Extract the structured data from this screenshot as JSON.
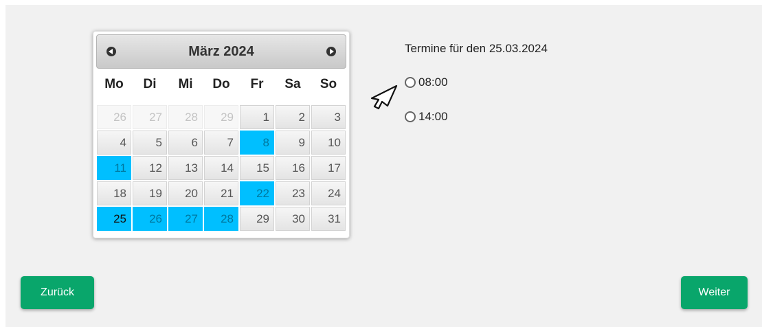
{
  "calendar": {
    "month_title": "März 2024",
    "weekdays": [
      "Mo",
      "Di",
      "Mi",
      "Do",
      "Fr",
      "Sa",
      "So"
    ],
    "days": [
      {
        "n": "26",
        "state": "other"
      },
      {
        "n": "27",
        "state": "other"
      },
      {
        "n": "28",
        "state": "other"
      },
      {
        "n": "29",
        "state": "other"
      },
      {
        "n": "1",
        "state": "normal"
      },
      {
        "n": "2",
        "state": "normal"
      },
      {
        "n": "3",
        "state": "normal"
      },
      {
        "n": "4",
        "state": "normal"
      },
      {
        "n": "5",
        "state": "normal"
      },
      {
        "n": "6",
        "state": "normal"
      },
      {
        "n": "7",
        "state": "normal"
      },
      {
        "n": "8",
        "state": "avail"
      },
      {
        "n": "9",
        "state": "normal"
      },
      {
        "n": "10",
        "state": "normal"
      },
      {
        "n": "11",
        "state": "avail"
      },
      {
        "n": "12",
        "state": "normal"
      },
      {
        "n": "13",
        "state": "normal"
      },
      {
        "n": "14",
        "state": "normal"
      },
      {
        "n": "15",
        "state": "normal"
      },
      {
        "n": "16",
        "state": "normal"
      },
      {
        "n": "17",
        "state": "normal"
      },
      {
        "n": "18",
        "state": "normal"
      },
      {
        "n": "19",
        "state": "normal"
      },
      {
        "n": "20",
        "state": "normal"
      },
      {
        "n": "21",
        "state": "normal"
      },
      {
        "n": "22",
        "state": "avail"
      },
      {
        "n": "23",
        "state": "normal"
      },
      {
        "n": "24",
        "state": "normal"
      },
      {
        "n": "25",
        "state": "selected"
      },
      {
        "n": "26",
        "state": "avail"
      },
      {
        "n": "27",
        "state": "avail"
      },
      {
        "n": "28",
        "state": "avail"
      },
      {
        "n": "29",
        "state": "normal"
      },
      {
        "n": "30",
        "state": "normal"
      },
      {
        "n": "31",
        "state": "normal"
      }
    ],
    "prev_icon": "circle-chevron-left-icon",
    "next_icon": "circle-chevron-right-icon",
    "available_color": "#00bfff"
  },
  "slots": {
    "title": "Termine für den 25.03.2024",
    "options": [
      "08:00",
      "14:00"
    ]
  },
  "buttons": {
    "back_label": "Zurück",
    "next_label": "Weiter",
    "color": "#09a66b"
  }
}
